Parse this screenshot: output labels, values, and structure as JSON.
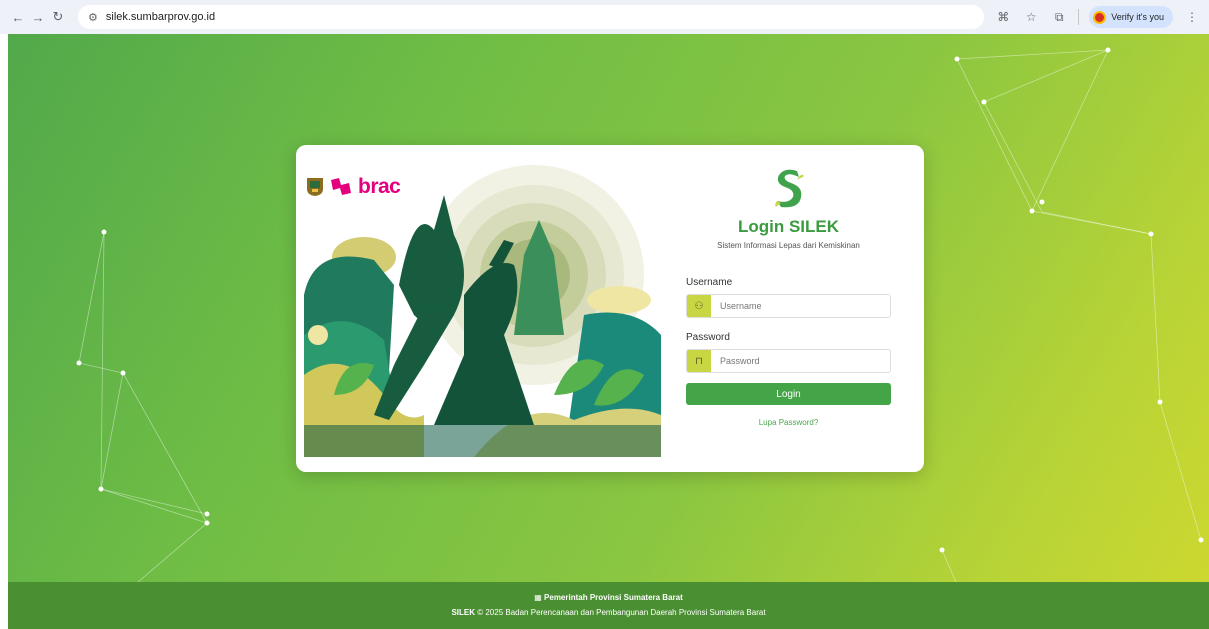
{
  "browser": {
    "url": "silek.sumbarprov.go.id",
    "profile_label": "Verify it's you"
  },
  "brand": {
    "partner_logo": "brac"
  },
  "login": {
    "title": "Login SILEK",
    "subtitle": "Sistem Informasi Lepas dari Kemiskinan",
    "username_label": "Username",
    "username_placeholder": "Username",
    "password_label": "Password",
    "password_placeholder": "Password",
    "button_label": "Login",
    "forgot_link": "Lupa Password?"
  },
  "footer": {
    "gov_name": "Pemerintah Provinsi Sumatera Barat",
    "app_name": "SILEK",
    "copyright": "© 2025 Badan Perencanaan dan Pembangunan Daerah Provinsi Sumatera Barat"
  },
  "colors": {
    "primary_green": "#43a548",
    "input_addon": "#c8d643",
    "footer_bg": "#4b8f33",
    "brac_magenta": "#e5007e"
  }
}
